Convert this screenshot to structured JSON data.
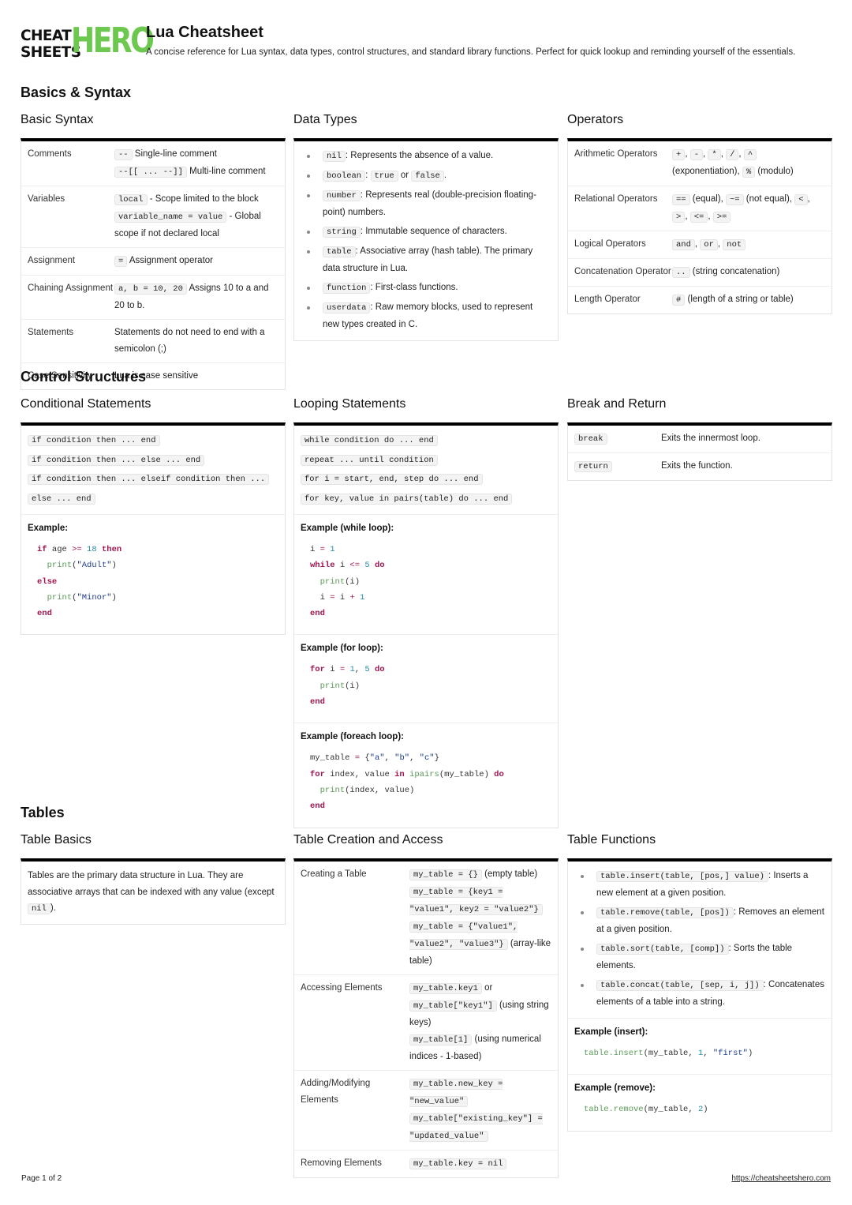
{
  "header": {
    "logo_line1": "CHEAT",
    "logo_line2": "SHEETS",
    "logo_hero": "HERO",
    "title": "Lua Cheatsheet",
    "description": "A concise reference for Lua syntax, data types, control structures, and standard library functions. Perfect for quick lookup and reminding yourself of the essentials."
  },
  "sections": {
    "basics": {
      "title": "Basics & Syntax",
      "basic_syntax": {
        "title": "Basic Syntax",
        "rows": [
          {
            "key": "Comments",
            "items": [
              {
                "code": "--",
                "text": " Single-line comment"
              },
              {
                "code": "--[[ ... --]]",
                "text": " Multi-line comment"
              }
            ]
          },
          {
            "key": "Variables",
            "items": [
              {
                "code": "local",
                "text": " - Scope limited to the block"
              },
              {
                "code": "variable_name = value",
                "text": " - Global scope if not declared local"
              }
            ]
          },
          {
            "key": "Assignment",
            "items": [
              {
                "code": "=",
                "text": " Assignment operator"
              }
            ]
          },
          {
            "key": "Chaining Assignment",
            "items": [
              {
                "code": "a, b = 10, 20",
                "text": " Assigns 10 to a and 20 to b."
              }
            ]
          },
          {
            "key": "Statements",
            "text": "Statements do not need to end with a semicolon (;)"
          },
          {
            "key": "Case Sensitivity",
            "text": "Lua is case sensitive"
          }
        ]
      },
      "data_types": {
        "title": "Data Types",
        "items": [
          {
            "code": "nil",
            "text": ": Represents the absence of a value."
          },
          {
            "code": "boolean",
            "text": ": ",
            "code2": "true",
            "text2": " or ",
            "code3": "false",
            "text3": "."
          },
          {
            "code": "number",
            "text": ": Represents real (double-precision floating-point) numbers."
          },
          {
            "code": "string",
            "text": ": Immutable sequence of characters."
          },
          {
            "code": "table",
            "text": ": Associative array (hash table). The primary data structure in Lua."
          },
          {
            "code": "function",
            "text": ": First-class functions."
          },
          {
            "code": "userdata",
            "text": ": Raw memory blocks, used to represent new types created in C."
          }
        ]
      },
      "operators": {
        "title": "Operators",
        "rows": [
          {
            "key": "Arithmetic Operators",
            "codes": [
              "+",
              "-",
              "*",
              "/",
              "^"
            ],
            "mid": "(exponentiation), ",
            "code_last": "%",
            "tail": " (modulo)"
          },
          {
            "key": "Relational Operators",
            "parts": [
              {
                "code": "==",
                "text": " (equal), "
              },
              {
                "code": "~=",
                "text": " (not equal), "
              },
              {
                "code": "<",
                "text": ", "
              },
              {
                "code": ">",
                "text": ", "
              },
              {
                "code": "<=",
                "text": ", "
              },
              {
                "code": ">=",
                "text": ""
              }
            ]
          },
          {
            "key": "Logical Operators",
            "parts": [
              {
                "code": "and",
                "text": ", "
              },
              {
                "code": "or",
                "text": ", "
              },
              {
                "code": "not",
                "text": ""
              }
            ]
          },
          {
            "key": "Concatenation Operator",
            "parts": [
              {
                "code": "..",
                "text": " (string concatenation)"
              }
            ]
          },
          {
            "key": "Length Operator",
            "parts": [
              {
                "code": "#",
                "text": " (length of a string or table)"
              }
            ]
          }
        ]
      }
    },
    "control": {
      "title": "Control Structures",
      "conditional": {
        "title": "Conditional Statements",
        "syntax": [
          "if condition then ... end",
          "if condition then ... else ... end",
          "if condition then ... elseif condition then ...",
          "else ... end"
        ],
        "example_label": "Example:"
      },
      "looping": {
        "title": "Looping Statements",
        "syntax": [
          "while condition do ... end",
          "repeat ... until condition",
          "for i = start, end, step do ... end",
          "for key, value in pairs(table) do ... end"
        ],
        "example_while_label": "Example (while loop):",
        "example_for_label": "Example (for loop):",
        "example_foreach_label": "Example (foreach loop):"
      },
      "break_return": {
        "title": "Break and Return",
        "rows": [
          {
            "code": "break",
            "text": "Exits the innermost loop."
          },
          {
            "code": "return",
            "text": "Exits the function."
          }
        ]
      }
    },
    "tables": {
      "title": "Tables",
      "basics": {
        "title": "Table Basics",
        "text_before": "Tables are the primary data structure in Lua. They are associative arrays that can be indexed with any value (except ",
        "code": "nil",
        "text_after": ")."
      },
      "creation": {
        "title": "Table Creation and Access",
        "rows": [
          {
            "key": "Creating a Table",
            "parts": [
              {
                "code": "my_table = {}",
                "text": " (empty table)"
              },
              {
                "code": "my_table = {key1 = \"value1\", key2 = \"value2\"}",
                "text": ""
              },
              {
                "code": "my_table = {\"value1\", \"value2\", \"value3\"}",
                "text": " (array-like table)"
              }
            ]
          },
          {
            "key": "Accessing Elements",
            "parts": [
              {
                "code": "my_table.key1",
                "text": " or "
              },
              {
                "code": "my_table[\"key1\"]",
                "text": " (using string keys)"
              },
              {
                "code": "my_table[1]",
                "text": " (using numerical indices - 1-based)"
              }
            ]
          },
          {
            "key": "Adding/Modifying Elements",
            "parts": [
              {
                "code": "my_table.new_key = \"new_value\"",
                "text": ""
              },
              {
                "code": "my_table[\"existing_key\"] = \"updated_value\"",
                "text": ""
              }
            ]
          },
          {
            "key": "Removing Elements",
            "parts": [
              {
                "code": "my_table.key = nil",
                "text": ""
              }
            ]
          }
        ]
      },
      "functions": {
        "title": "Table Functions",
        "items": [
          {
            "code": "table.insert(table, [pos,] value)",
            "text": ": Inserts a new element at a given position."
          },
          {
            "code": "table.remove(table, [pos])",
            "text": ": Removes an element at a given position."
          },
          {
            "code": "table.sort(table, [comp])",
            "text": ": Sorts the table elements."
          },
          {
            "code": "table.concat(table, [sep, i, j])",
            "text": ": Concatenates elements of a table into a string."
          }
        ],
        "example_insert_label": "Example (insert):",
        "example_remove_label": "Example (remove):"
      }
    }
  },
  "footer": {
    "page": "Page 1 of 2",
    "url": "https://cheatsheetshero.com"
  },
  "colors": {
    "brand_green": "#6cc84f",
    "keyword": "#a0144f",
    "number": "#2a8ea8",
    "string": "#1f3d8a",
    "function": "#5a9a5a"
  }
}
